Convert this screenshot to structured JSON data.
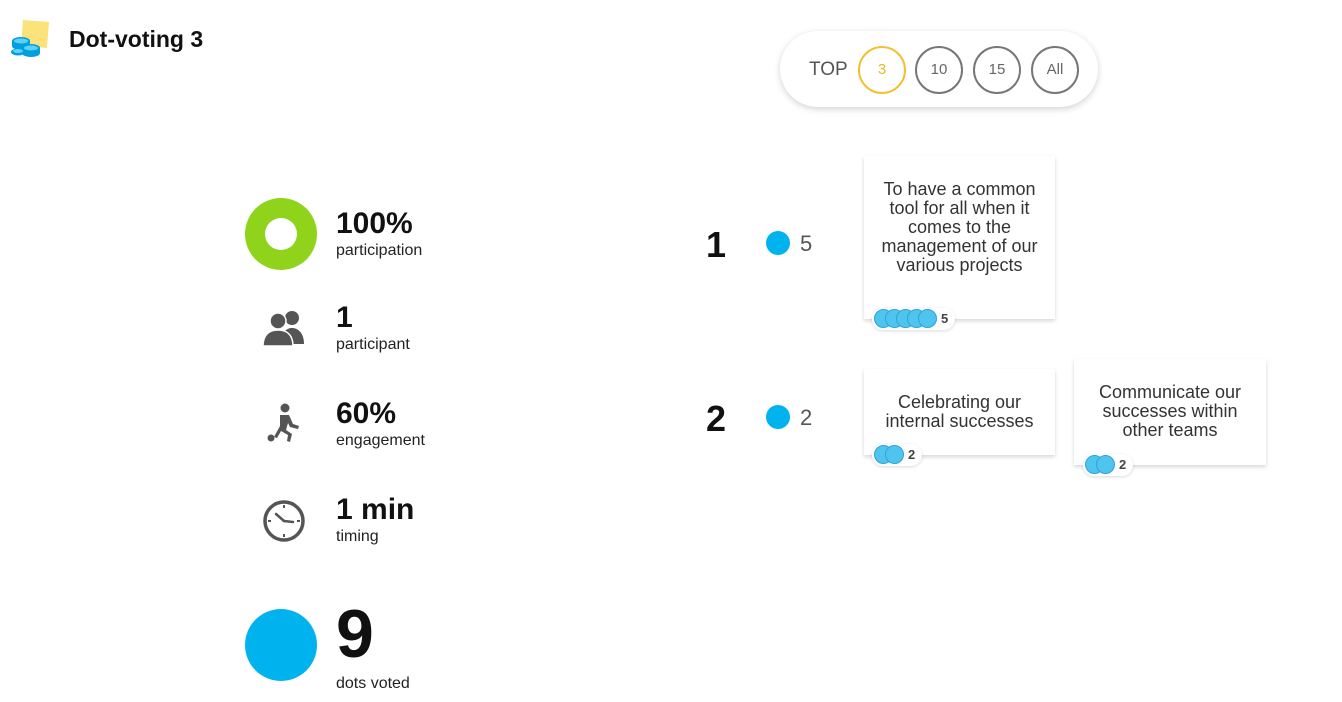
{
  "header": {
    "title": "Dot-voting 3",
    "logo_icon": "sticky-note-coins-icon"
  },
  "top_filter": {
    "label": "TOP",
    "options": [
      "3",
      "10",
      "15",
      "All"
    ],
    "selected": "3"
  },
  "stats": {
    "participation": {
      "value": "100%",
      "label": "participation",
      "fraction": 1.0,
      "icon": "donut-chart-icon"
    },
    "participants": {
      "value": "1",
      "label": "participant",
      "icon": "users-icon"
    },
    "engagement": {
      "value": "60%",
      "label": "engagement",
      "icon": "running-player-icon"
    },
    "timing": {
      "value": "1 min",
      "label": "timing",
      "icon": "clock-icon"
    },
    "dots": {
      "value": "9",
      "label": "dots voted",
      "icon": "dot-icon"
    }
  },
  "ranking": [
    {
      "rank": "1",
      "votes": "5",
      "cards": [
        {
          "text": "To have a common tool for all when it comes to the management of our various projects",
          "votes": "5",
          "dots": 5
        }
      ]
    },
    {
      "rank": "2",
      "votes": "2",
      "cards": [
        {
          "text": "Celebrating our internal successes",
          "votes": "2",
          "dots": 2
        },
        {
          "text": "Communicate our successes within other teams",
          "votes": "2",
          "dots": 2
        }
      ]
    }
  ],
  "colors": {
    "accent_yellow": "#f3c030",
    "dot_blue": "#00b3ef",
    "participation_green": "#8fd41a"
  }
}
